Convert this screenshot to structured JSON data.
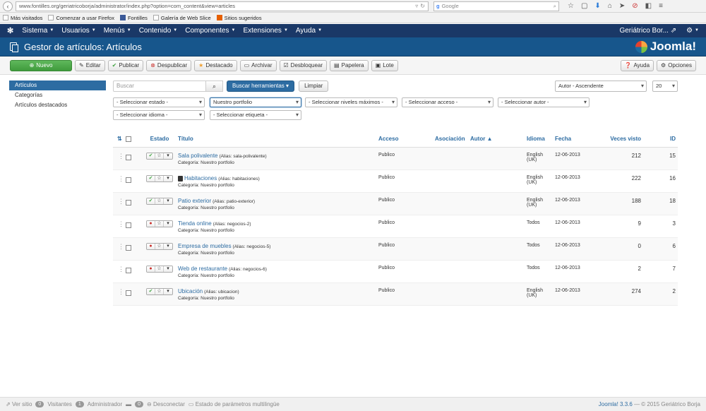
{
  "browser": {
    "url": "www.fontilles.org/geriatricoborja/administrator/index.php?option=com_content&view=articles",
    "search_placeholder": "Google",
    "bookmarks": [
      "Más visitados",
      "Comenzar a usar Firefox",
      "Fontilles",
      "Galería de Web Slice",
      "Sitios sugeridos"
    ]
  },
  "navbar": {
    "items": [
      "Sistema",
      "Usuarios",
      "Menús",
      "Contenido",
      "Componentes",
      "Extensiones",
      "Ayuda"
    ],
    "site_name": "Geriátrico Bor..."
  },
  "header": {
    "title": "Gestor de artículos: Artículos",
    "brand": "Joomla!"
  },
  "toolbar": {
    "new": "Nuevo",
    "edit": "Editar",
    "publish": "Publicar",
    "unpublish": "Despublicar",
    "featured": "Destacado",
    "archive": "Archivar",
    "checkin": "Desbloquear",
    "trash": "Papelera",
    "batch": "Lote",
    "help": "Ayuda",
    "options": "Opciones"
  },
  "sidebar": {
    "items": [
      "Artículos",
      "Categorías",
      "Artículos destacados"
    ]
  },
  "search": {
    "placeholder": "Buscar",
    "tools": "Buscar herramientas",
    "clear": "Limpiar",
    "ordering": "Autor - Ascendente",
    "limit": "20"
  },
  "filters": {
    "state": "- Seleccionar estado -",
    "category": "Nuestro portfolio",
    "levels": "- Seleccionar niveles máximos -",
    "access": "- Seleccionar acceso -",
    "author": "- Seleccionar autor -",
    "language": "- Seleccionar idioma -",
    "tag": "- Seleccionar etiqueta -"
  },
  "table": {
    "columns": [
      "Estado",
      "Título",
      "Acceso",
      "Asociación",
      "Autor",
      "Idioma",
      "Fecha",
      "Veces visto",
      "ID"
    ],
    "alias_prefix": "(Alias:",
    "category_prefix": "Categoría:",
    "rows": [
      {
        "title": "Sala polivalente",
        "alias": "sala-polivalente",
        "category": "Nuestro portfolio",
        "status": "published",
        "locked": false,
        "access": "Publico",
        "lang1": "English",
        "lang2": "(UK)",
        "date": "12-06-2013",
        "hits": "212",
        "id": "15"
      },
      {
        "title": "Habitaciones",
        "alias": "habitaciones",
        "category": "Nuestro portfolio",
        "status": "published",
        "locked": true,
        "access": "Publico",
        "lang1": "English",
        "lang2": "(UK)",
        "date": "12-06-2013",
        "hits": "222",
        "id": "16"
      },
      {
        "title": "Patio exterior",
        "alias": "patio-exterior",
        "category": "Nuestro portfolio",
        "status": "published",
        "locked": false,
        "access": "Publico",
        "lang1": "English",
        "lang2": "(UK)",
        "date": "12-06-2013",
        "hits": "188",
        "id": "18"
      },
      {
        "title": "Tienda online",
        "alias": "negocios-2",
        "category": "Nuestro portfolio",
        "status": "unpublished",
        "locked": false,
        "access": "Publico",
        "lang1": "Todos",
        "lang2": "",
        "date": "12-06-2013",
        "hits": "9",
        "id": "3"
      },
      {
        "title": "Empresa de muebles",
        "alias": "negocios-5",
        "category": "Nuestro portfolio",
        "status": "unpublished",
        "locked": false,
        "access": "Publico",
        "lang1": "Todos",
        "lang2": "",
        "date": "12-06-2013",
        "hits": "0",
        "id": "6"
      },
      {
        "title": "Web de restaurante",
        "alias": "negocios-6",
        "category": "Nuestro portfolio",
        "status": "unpublished",
        "locked": false,
        "access": "Publico",
        "lang1": "Todos",
        "lang2": "",
        "date": "12-06-2013",
        "hits": "2",
        "id": "7"
      },
      {
        "title": "Ubicación",
        "alias": "ubicacion",
        "category": "Nuestro portfolio",
        "status": "published",
        "locked": false,
        "access": "Publico",
        "lang1": "English",
        "lang2": "(UK)",
        "date": "12-06-2013",
        "hits": "274",
        "id": "2"
      }
    ]
  },
  "statusbar": {
    "view_site": "Ver sitio",
    "visitors_count": "0",
    "visitors": "Visitantes",
    "admin_count": "1",
    "admin": "Administrador",
    "messages_count": "0",
    "logout": "Desconectar",
    "multilang": "Estado de parámetros multilingüe",
    "version": "Joomla! 3.3.6",
    "copyright": "— © 2015 Geriátrico Borja"
  }
}
